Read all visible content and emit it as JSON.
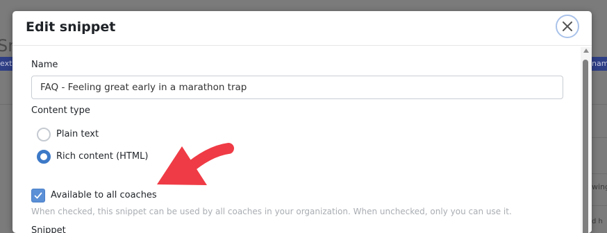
{
  "background": {
    "title_fragment": "Sn",
    "left_strip_text": "ext o",
    "right_strip_text": "nam",
    "right_text_1": "wing",
    "right_text_2": "d h"
  },
  "modal": {
    "title": "Edit snippet",
    "close_icon": "close-icon",
    "name_label": "Name",
    "name_value": "FAQ - Feeling great early in a marathon trap",
    "content_type_label": "Content type",
    "content_type_options": [
      {
        "label": "Plain text",
        "checked": false
      },
      {
        "label": "Rich content (HTML)",
        "checked": true
      }
    ],
    "available_label": "Available to all coaches",
    "available_checked": true,
    "available_help": "When checked, this snippet can be used by all coaches in your organization. When unchecked, only you can use it.",
    "snippet_label": "Snippet"
  },
  "annotation": {
    "arrow_color": "#ef3b45"
  },
  "colors": {
    "accent": "#3c79c7",
    "checkbox": "#5b8fd6",
    "overlay": "#7b7b7b"
  }
}
